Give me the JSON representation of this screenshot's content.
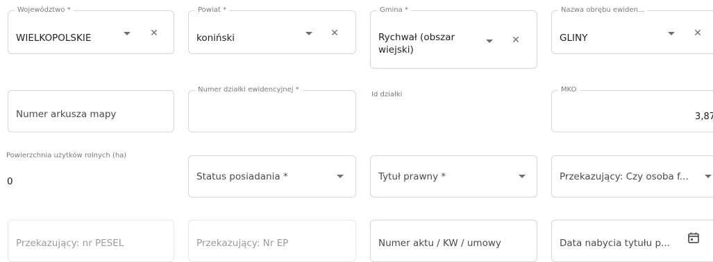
{
  "row1": {
    "wojewodztwo": {
      "label": "Województwo *",
      "value": "WIELKOPOLSKIE",
      "clear": "✕"
    },
    "powiat": {
      "label": "Powiat *",
      "value": "koniński",
      "clear": "✕"
    },
    "gmina": {
      "label": "Gmina *",
      "value": "Rychwał (obszar wiejski)",
      "clear": "✕"
    },
    "obreb": {
      "label": "Nazwa obrębu ewiden...",
      "value": "GLINY",
      "clear": "✕"
    }
  },
  "row2": {
    "arkusz": {
      "placeholder": "Numer arkusza mapy"
    },
    "dzialka": {
      "label": "Numer działki ewidencyjnej *"
    },
    "id_dzialki": {
      "label": "Id działki"
    },
    "mko": {
      "label": "MKO",
      "value": "3,87"
    }
  },
  "row3": {
    "powierzchnia": {
      "label": "Powierzchnia użytków rolnych (ha)",
      "value": "0"
    },
    "status": {
      "placeholder": "Status posiadania *"
    },
    "tytul": {
      "placeholder": "Tytuł prawny *"
    },
    "przekazujacy_osoba": {
      "placeholder": "Przekazujący: Czy osoba f..."
    }
  },
  "row4": {
    "pesel": {
      "placeholder": "Przekazujący: nr PESEL"
    },
    "nr_ep": {
      "placeholder": "Przekazujący: Nr EP"
    },
    "akt": {
      "placeholder": "Numer aktu / KW / umowy"
    },
    "data": {
      "placeholder": "Data nabycia tytułu p..."
    }
  },
  "icons": {
    "dropdown": "chevron-down-icon",
    "clear": "close-icon",
    "calendar": "calendar-icon"
  },
  "colors": {
    "border": "#d6d6d6",
    "label": "#7a7a7a",
    "text": "#1e1e1e",
    "disabled_text": "#9a9a9a"
  }
}
